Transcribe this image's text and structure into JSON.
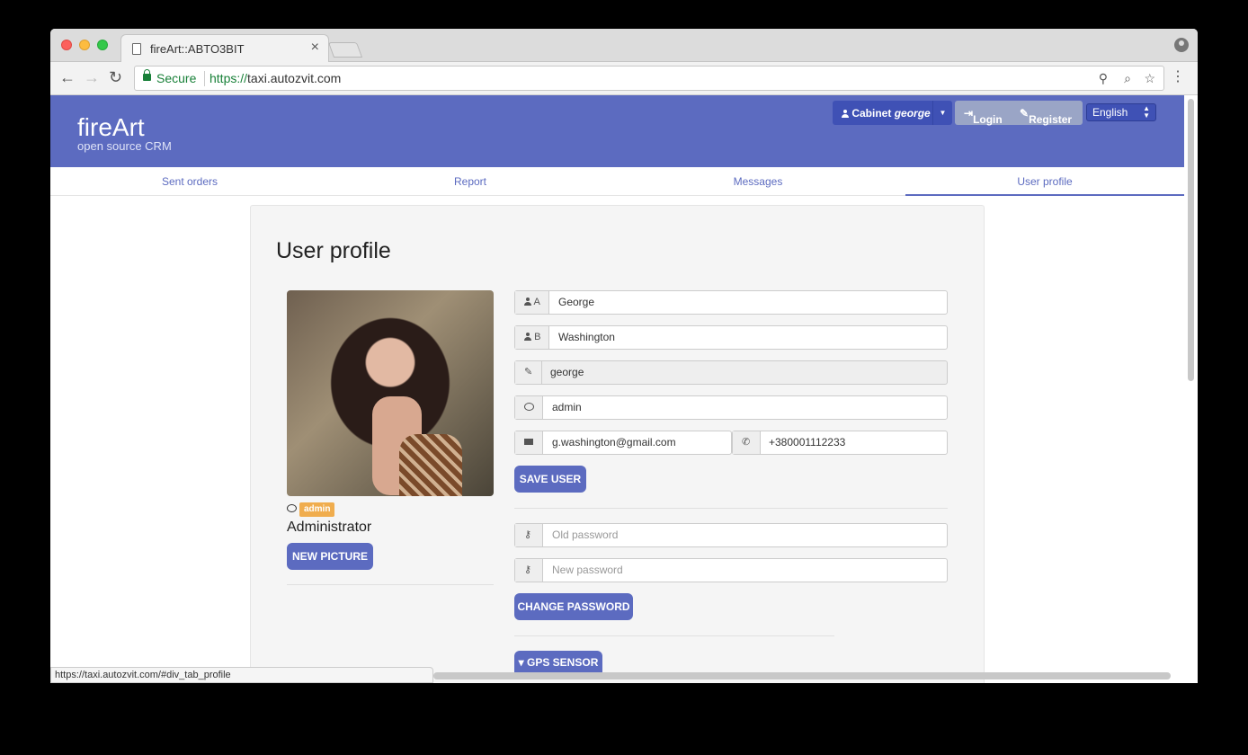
{
  "browser": {
    "tab_title": "fireArt::ABTO3BIT",
    "secure_label": "Secure",
    "url_scheme": "https://",
    "url_host": "taxi.autozvit.com",
    "status_url": "https://taxi.autozvit.com/#div_tab_profile"
  },
  "header": {
    "brand": "fireArt",
    "brand_sub": "open source CRM",
    "cabinet_label": "Cabinet",
    "cabinet_user": "george",
    "login_label": "Login",
    "register_label": "Register",
    "language": "English"
  },
  "tabs": [
    {
      "label": "Sent orders"
    },
    {
      "label": "Report"
    },
    {
      "label": "Messages"
    },
    {
      "label": "User profile"
    }
  ],
  "profile": {
    "title": "User profile",
    "role_badge": "admin",
    "role_name": "Administrator",
    "new_picture_label": "NEW PICTURE",
    "first_name_addon": "A",
    "first_name": "George",
    "last_name_addon": "B",
    "last_name": "Washington",
    "login": "george",
    "role_field": "admin",
    "email": "g.washington@gmail.com",
    "phone": "+380001112233",
    "save_label": "SAVE USER",
    "old_password_placeholder": "Old password",
    "new_password_placeholder": "New password",
    "change_password_label": "CHANGE PASSWORD",
    "gps_label": "GPS SENSOR"
  },
  "colors": {
    "accent": "#5c6bc0",
    "badge": "#f0ad4e",
    "secure": "#188038"
  }
}
